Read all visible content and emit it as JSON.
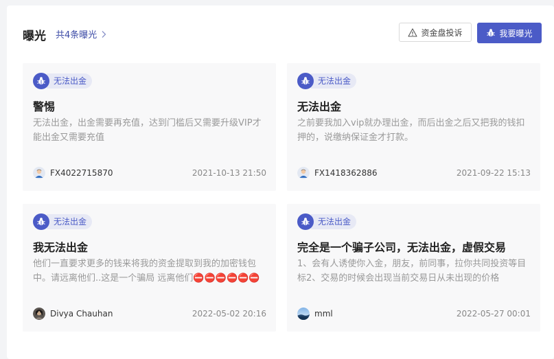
{
  "header": {
    "title": "曝光",
    "count_label": "共4条曝光",
    "complaint_button": "资金盘投诉",
    "expose_button": "我要曝光"
  },
  "colors": {
    "accent": "#4b5bc7",
    "tag_bg": "#e7e9f5",
    "card_bg": "#f8f8f9"
  },
  "cards": [
    {
      "tag": "无法出金",
      "title": "警惕",
      "description": "无法出金，出金需要再充值，达到门槛后又需要升级VIP才能出金又需要充值",
      "user": "FX4022715870",
      "time": "2021-10-13 21:50",
      "avatar_icon": "default-user-avatar-icon"
    },
    {
      "tag": "无法出金",
      "title": "无法出金",
      "description": "之前要我加入vip就办理出金，而后出金之后又把我的钱扣押的，说缴纳保证金才打款。",
      "user": "FX1418362886",
      "time": "2021-09-22 15:13",
      "avatar_icon": "default-user-avatar-icon"
    },
    {
      "tag": "无法出金",
      "title": "我无法出金",
      "description": "他们一直要求更多的钱来将我的资金提取到我的加密钱包中。请远离他们..这是一个骗局 远离他们⛔⛔⛔⛔⛔⛔",
      "user": "Divya Chauhan",
      "time": "2022-05-02 20:16",
      "avatar_icon": "photo-avatar-icon"
    },
    {
      "tag": "无法出金",
      "title": "完全是一个骗子公司，无法出金，虚假交易",
      "description": "1、会有人诱使你入金，朋友，前同事，拉你共同投资等目标2、交易的时候会出现当前交易日从未出现的价格",
      "user": "mml",
      "time": "2022-05-27 00:01",
      "avatar_icon": "landscape-avatar-icon"
    }
  ]
}
